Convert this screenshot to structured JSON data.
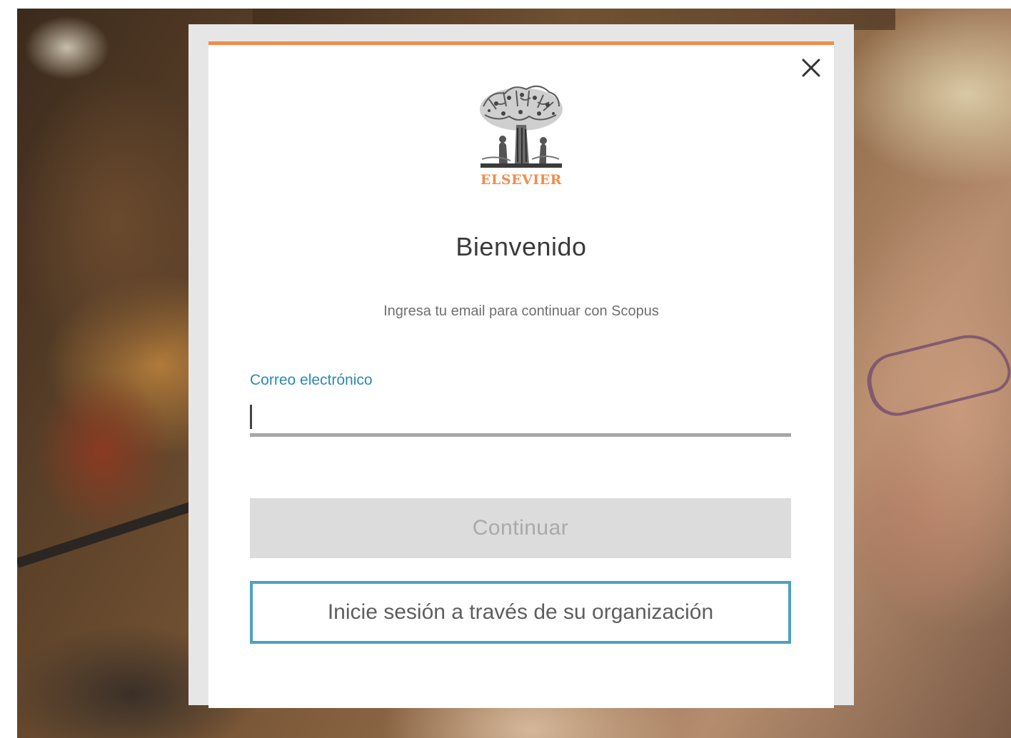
{
  "background": {
    "image_name": "conference-audience-photo"
  },
  "modal": {
    "accent_color": "#f38b4a",
    "close_icon": "close-icon",
    "logo": {
      "icon": "elsevier-tree-logo",
      "wordmark": "ELSEVIER"
    },
    "title": "Bienvenido",
    "subtitle": "Ingresa tu email para continuar con Scopus",
    "email_field": {
      "label": "Correo electrónico",
      "value": "",
      "placeholder": ""
    },
    "continue_button": {
      "label": "Continuar",
      "state": "disabled"
    },
    "org_button": {
      "label": "Inicie sesión a través de su organización",
      "border_color": "#4ea1c2"
    }
  }
}
